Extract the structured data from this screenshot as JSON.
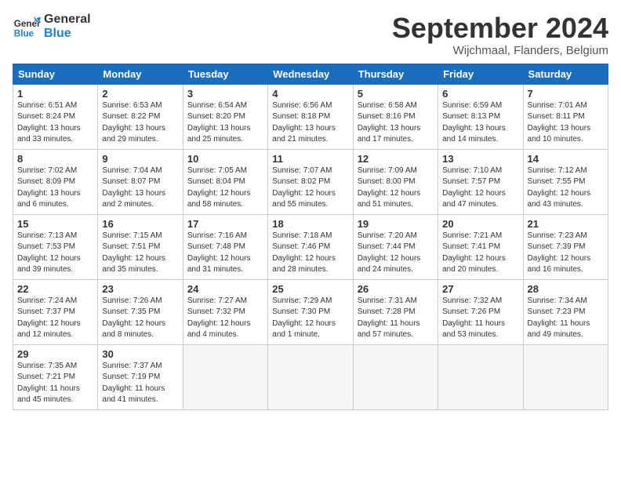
{
  "header": {
    "logo_general": "General",
    "logo_blue": "Blue",
    "month_title": "September 2024",
    "subtitle": "Wijchmaal, Flanders, Belgium"
  },
  "weekdays": [
    "Sunday",
    "Monday",
    "Tuesday",
    "Wednesday",
    "Thursday",
    "Friday",
    "Saturday"
  ],
  "weeks": [
    [
      {
        "day": "1",
        "info": "Sunrise: 6:51 AM\nSunset: 8:24 PM\nDaylight: 13 hours\nand 33 minutes."
      },
      {
        "day": "2",
        "info": "Sunrise: 6:53 AM\nSunset: 8:22 PM\nDaylight: 13 hours\nand 29 minutes."
      },
      {
        "day": "3",
        "info": "Sunrise: 6:54 AM\nSunset: 8:20 PM\nDaylight: 13 hours\nand 25 minutes."
      },
      {
        "day": "4",
        "info": "Sunrise: 6:56 AM\nSunset: 8:18 PM\nDaylight: 13 hours\nand 21 minutes."
      },
      {
        "day": "5",
        "info": "Sunrise: 6:58 AM\nSunset: 8:16 PM\nDaylight: 13 hours\nand 17 minutes."
      },
      {
        "day": "6",
        "info": "Sunrise: 6:59 AM\nSunset: 8:13 PM\nDaylight: 13 hours\nand 14 minutes."
      },
      {
        "day": "7",
        "info": "Sunrise: 7:01 AM\nSunset: 8:11 PM\nDaylight: 13 hours\nand 10 minutes."
      }
    ],
    [
      {
        "day": "8",
        "info": "Sunrise: 7:02 AM\nSunset: 8:09 PM\nDaylight: 13 hours\nand 6 minutes."
      },
      {
        "day": "9",
        "info": "Sunrise: 7:04 AM\nSunset: 8:07 PM\nDaylight: 13 hours\nand 2 minutes."
      },
      {
        "day": "10",
        "info": "Sunrise: 7:05 AM\nSunset: 8:04 PM\nDaylight: 12 hours\nand 58 minutes."
      },
      {
        "day": "11",
        "info": "Sunrise: 7:07 AM\nSunset: 8:02 PM\nDaylight: 12 hours\nand 55 minutes."
      },
      {
        "day": "12",
        "info": "Sunrise: 7:09 AM\nSunset: 8:00 PM\nDaylight: 12 hours\nand 51 minutes."
      },
      {
        "day": "13",
        "info": "Sunrise: 7:10 AM\nSunset: 7:57 PM\nDaylight: 12 hours\nand 47 minutes."
      },
      {
        "day": "14",
        "info": "Sunrise: 7:12 AM\nSunset: 7:55 PM\nDaylight: 12 hours\nand 43 minutes."
      }
    ],
    [
      {
        "day": "15",
        "info": "Sunrise: 7:13 AM\nSunset: 7:53 PM\nDaylight: 12 hours\nand 39 minutes."
      },
      {
        "day": "16",
        "info": "Sunrise: 7:15 AM\nSunset: 7:51 PM\nDaylight: 12 hours\nand 35 minutes."
      },
      {
        "day": "17",
        "info": "Sunrise: 7:16 AM\nSunset: 7:48 PM\nDaylight: 12 hours\nand 31 minutes."
      },
      {
        "day": "18",
        "info": "Sunrise: 7:18 AM\nSunset: 7:46 PM\nDaylight: 12 hours\nand 28 minutes."
      },
      {
        "day": "19",
        "info": "Sunrise: 7:20 AM\nSunset: 7:44 PM\nDaylight: 12 hours\nand 24 minutes."
      },
      {
        "day": "20",
        "info": "Sunrise: 7:21 AM\nSunset: 7:41 PM\nDaylight: 12 hours\nand 20 minutes."
      },
      {
        "day": "21",
        "info": "Sunrise: 7:23 AM\nSunset: 7:39 PM\nDaylight: 12 hours\nand 16 minutes."
      }
    ],
    [
      {
        "day": "22",
        "info": "Sunrise: 7:24 AM\nSunset: 7:37 PM\nDaylight: 12 hours\nand 12 minutes."
      },
      {
        "day": "23",
        "info": "Sunrise: 7:26 AM\nSunset: 7:35 PM\nDaylight: 12 hours\nand 8 minutes."
      },
      {
        "day": "24",
        "info": "Sunrise: 7:27 AM\nSunset: 7:32 PM\nDaylight: 12 hours\nand 4 minutes."
      },
      {
        "day": "25",
        "info": "Sunrise: 7:29 AM\nSunset: 7:30 PM\nDaylight: 12 hours\nand 1 minute."
      },
      {
        "day": "26",
        "info": "Sunrise: 7:31 AM\nSunset: 7:28 PM\nDaylight: 11 hours\nand 57 minutes."
      },
      {
        "day": "27",
        "info": "Sunrise: 7:32 AM\nSunset: 7:26 PM\nDaylight: 11 hours\nand 53 minutes."
      },
      {
        "day": "28",
        "info": "Sunrise: 7:34 AM\nSunset: 7:23 PM\nDaylight: 11 hours\nand 49 minutes."
      }
    ],
    [
      {
        "day": "29",
        "info": "Sunrise: 7:35 AM\nSunset: 7:21 PM\nDaylight: 11 hours\nand 45 minutes."
      },
      {
        "day": "30",
        "info": "Sunrise: 7:37 AM\nSunset: 7:19 PM\nDaylight: 11 hours\nand 41 minutes."
      },
      {
        "day": "",
        "info": ""
      },
      {
        "day": "",
        "info": ""
      },
      {
        "day": "",
        "info": ""
      },
      {
        "day": "",
        "info": ""
      },
      {
        "day": "",
        "info": ""
      }
    ]
  ]
}
